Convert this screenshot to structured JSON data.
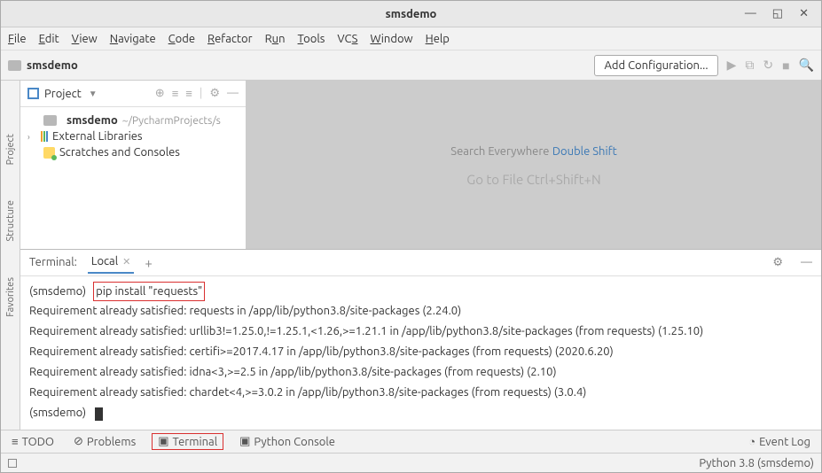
{
  "window": {
    "title": "smsdemo"
  },
  "menubar": [
    "File",
    "Edit",
    "View",
    "Navigate",
    "Code",
    "Refactor",
    "Run",
    "Tools",
    "VCS",
    "Window",
    "Help"
  ],
  "navbar": {
    "project": "smsdemo",
    "add_config": "Add Configuration..."
  },
  "project_tool": {
    "label": "Project",
    "root": "smsdemo",
    "root_path": "~/PycharmProjects/s",
    "external": "External Libraries",
    "scratches": "Scratches and Consoles"
  },
  "left_tabs": [
    "Project",
    "Structure",
    "Favorites"
  ],
  "editor_hints": {
    "search": "Search Everywhere",
    "search_key": "Double Shift",
    "goto": "Go to File Ctrl+Shift+N"
  },
  "terminal": {
    "title": "Terminal:",
    "tab": "Local",
    "prompt1": "(smsdemo)",
    "command": "pip install \"requests\"",
    "lines": [
      "Requirement already satisfied: requests in /app/lib/python3.8/site-packages (2.24.0)",
      "Requirement already satisfied: urllib3!=1.25.0,!=1.25.1,<1.26,>=1.21.1 in /app/lib/python3.8/site-packages (from requests) (1.25.10)",
      "Requirement already satisfied: certifi>=2017.4.17 in /app/lib/python3.8/site-packages (from requests) (2020.6.20)",
      "Requirement already satisfied: idna<3,>=2.5 in /app/lib/python3.8/site-packages (from requests) (2.10)",
      "Requirement already satisfied: chardet<4,>=3.0.2 in /app/lib/python3.8/site-packages (from requests) (3.0.4)"
    ],
    "prompt2": "(smsdemo)"
  },
  "bottombar": {
    "todo": "TODO",
    "problems": "Problems",
    "terminal": "Terminal",
    "python_console": "Python Console",
    "event_log": "Event Log"
  },
  "statusbar": {
    "interpreter": "Python 3.8 (smsdemo)"
  }
}
